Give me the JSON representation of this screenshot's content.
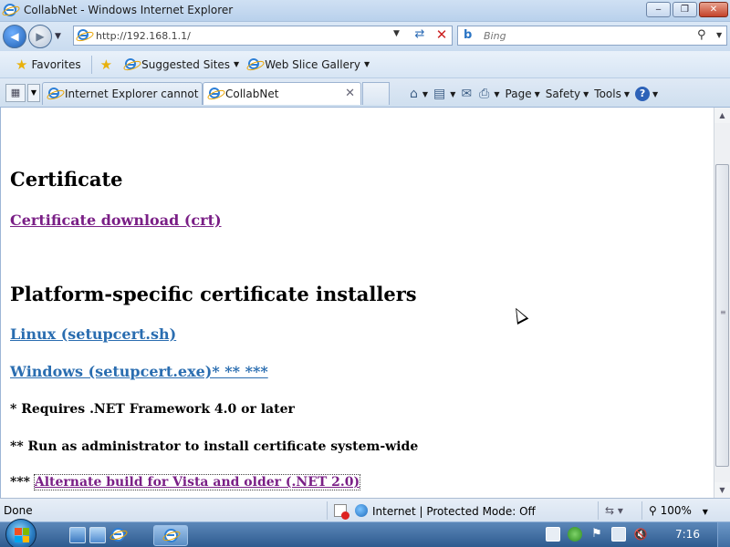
{
  "window": {
    "title": "CollabNet - Windows Internet Explorer",
    "controls": {
      "minimize": "‒",
      "maximize": "❐",
      "close": "✕"
    }
  },
  "navigation": {
    "back_icon": "back-arrow-icon",
    "forward_icon": "forward-arrow-icon",
    "address": {
      "value": "http://192.168.1.1/"
    },
    "search": {
      "placeholder": "Bing",
      "logo": "b"
    }
  },
  "favorites_bar": {
    "favorites_label": "Favorites",
    "items": [
      {
        "label": "Suggested Sites",
        "has_dropdown": true
      },
      {
        "label": "Web Slice Gallery",
        "has_dropdown": true
      }
    ]
  },
  "tabs": [
    {
      "label": "Internet Explorer cannot d...",
      "active": false
    },
    {
      "label": "CollabNet",
      "active": true,
      "close": "✕"
    }
  ],
  "commands": {
    "page": "Page",
    "safety": "Safety",
    "tools": "Tools",
    "help": "?"
  },
  "content": {
    "certificate_heading": "Certificate",
    "certificate_link": "Certificate download (crt)",
    "installers_heading": "Platform-specific certificate installers",
    "linux_link": "Linux (setupcert.sh)",
    "windows_link": "Windows (setupcert.exe)* ** ***",
    "note1": "* Requires .NET Framework 4.0 or later",
    "note2": "** Run as administrator to install certificate system-wide",
    "note3_prefix": "***",
    "note3_link": "Alternate build for Vista and older (.NET 2.0)"
  },
  "status_bar": {
    "status": "Done",
    "zone": "Internet | Protected Mode: Off",
    "zoom": "100%"
  },
  "taskbar": {
    "clock": "7:16"
  },
  "colors": {
    "visited_link": "#7a1f86",
    "unvisited_link": "#2a6db0",
    "taskbar": "#2e5b8f"
  }
}
